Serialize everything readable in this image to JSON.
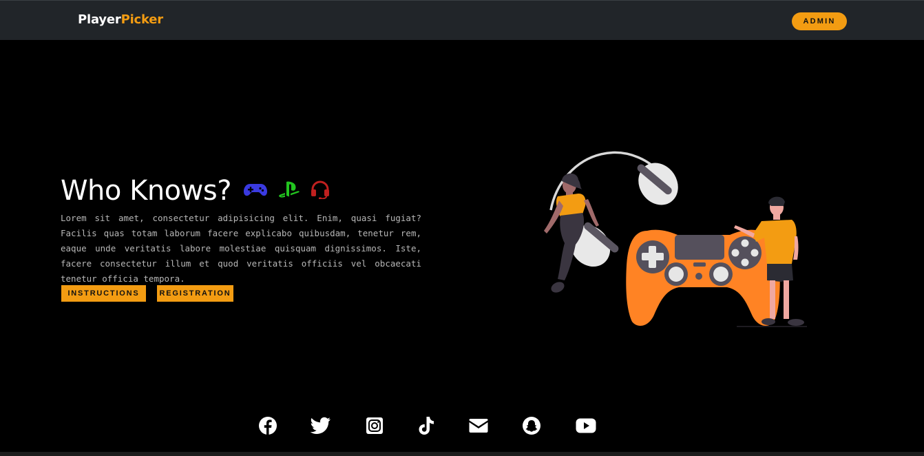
{
  "navbar": {
    "brand_part1": "Player",
    "brand_part2": "Picker",
    "admin_label": "ADMIN"
  },
  "hero": {
    "title": "Who Knows?",
    "title_icons": [
      "gamepad-icon",
      "playstation-icon",
      "headset-icon"
    ],
    "paragraph": "Lorem sit amet, consectetur adipisicing elit. Enim, quasi fugiat? Facilis quas totam laborum facere explicabo quibusdam, tenetur rem, eaque unde veritatis labore molestiae quisquam dignissimos. Iste, facere consectetur illum et quod veritatis officiis vel obcaecati tenetur officia tempora.",
    "buttons": {
      "instructions": "INSTRUCTIONS",
      "registration": "REGISTRATION"
    }
  },
  "socials": [
    "facebook-icon",
    "twitter-icon",
    "instagram-icon",
    "tiktok-icon",
    "envelope-icon",
    "snapchat-icon",
    "youtube-icon"
  ],
  "colors": {
    "accent": "#f39c12",
    "navbar": "#212529",
    "background": "#000000",
    "gamepad_icon": "#3a3ae0",
    "playstation_icon": "#22c41f",
    "headset_icon": "#c0201f",
    "controller": "#ff8324"
  }
}
